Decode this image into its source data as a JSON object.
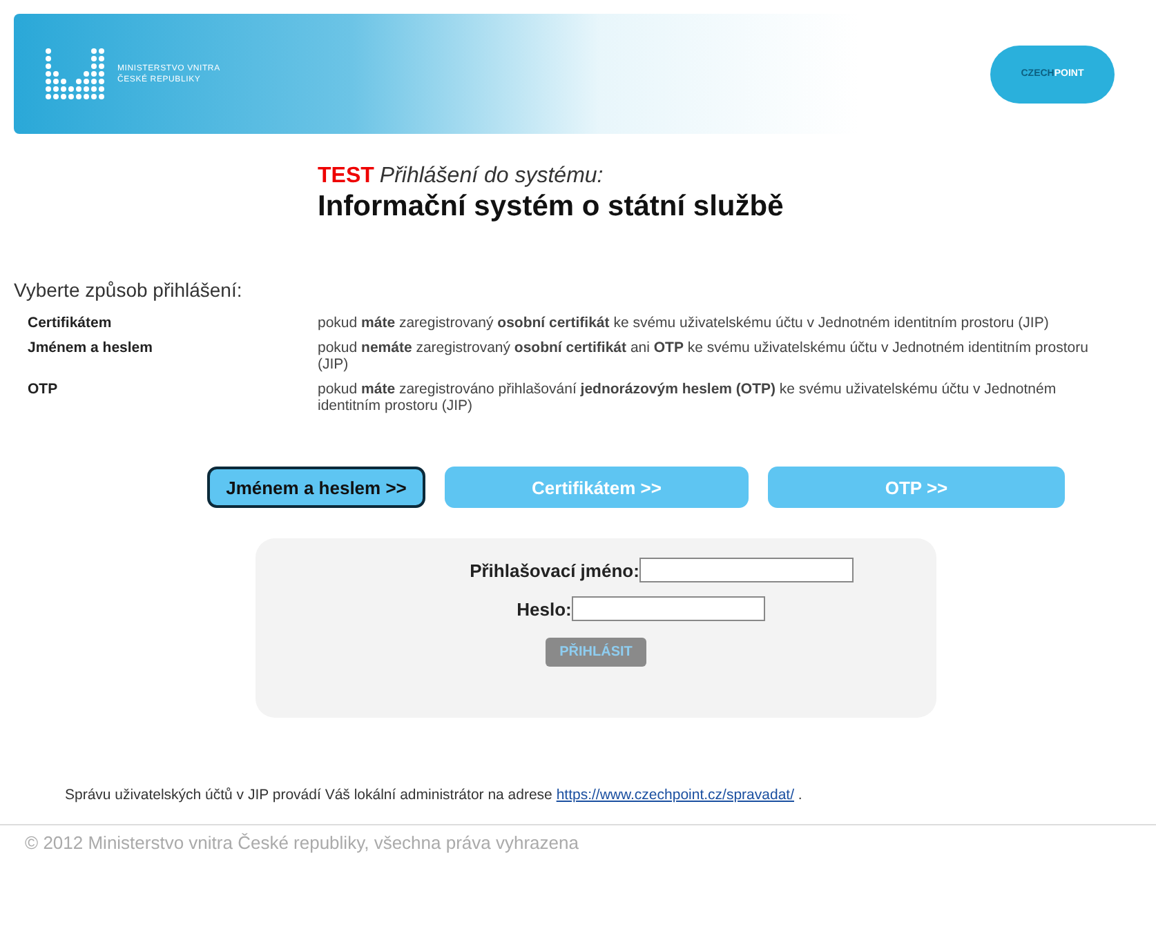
{
  "header": {
    "ministry_lines": [
      "MINISTERSTVO VNITRA",
      "ČESKÉ REPUBLIKY"
    ],
    "logo_parts": [
      "CZECH",
      "POINT"
    ]
  },
  "title": {
    "badge": "TEST",
    "subtitle": "Přihlášení do systému:",
    "heading": "Informační systém o státní službě"
  },
  "prompt": "Vyberte způsob přihlášení:",
  "methods": [
    {
      "name": "Certifikátem",
      "description": "pokud **máte** zaregistrovaný **osobní certifikát** ke svému uživatelskému účtu v Jednotném identitním prostoru (JIP)"
    },
    {
      "name": "Jménem a heslem",
      "description": "pokud **nemáte** zaregistrovaný **osobní certifikát** ani **OTP** ke svému uživatelskému účtu v Jednotném identitním prostoru (JIP)"
    },
    {
      "name": "OTP",
      "description": "pokud **máte** zaregistrováno přihlašování **jednorázovým heslem (OTP)** ke svému uživatelskému účtu v Jednotném identitním prostoru (JIP)"
    }
  ],
  "tabs": [
    {
      "label": "Jménem a heslem >>",
      "selected": true
    },
    {
      "label": "Certifikátem >>",
      "selected": false
    },
    {
      "label": "OTP >>",
      "selected": false
    }
  ],
  "form": {
    "fields": [
      {
        "label": "Přihlašovací jméno:"
      },
      {
        "label": "Heslo:"
      }
    ],
    "submit": {
      "label": "PŘIHLÁSIT",
      "disabled": true
    }
  },
  "footer": {
    "text": "Správu uživatelských účtů v JIP provádí Váš lokální administrátor na adrese",
    "link": "https://www.czechpoint.cz/spravadat/",
    "trail": ".",
    "copyright": "© 2012 Ministerstvo vnitra České republiky, všechna práva vyhrazena"
  }
}
